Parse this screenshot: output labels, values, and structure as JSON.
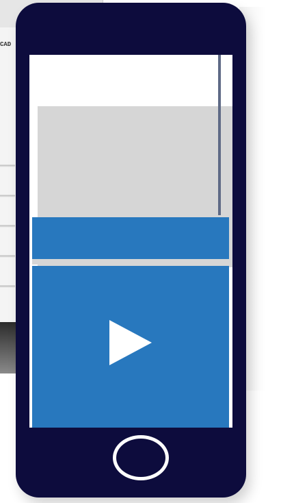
{
  "background": {
    "label": "CAD"
  },
  "phone": {
    "body_color": "#0d0c3d",
    "screen_color": "#ffffff",
    "panel_color": "#d6d6d6",
    "accent_color": "#2878be",
    "scrollbar_color": "#5f6a86"
  },
  "video": {
    "play_icon": "play-icon"
  },
  "controls": {
    "home_icon": "home-button-icon"
  }
}
